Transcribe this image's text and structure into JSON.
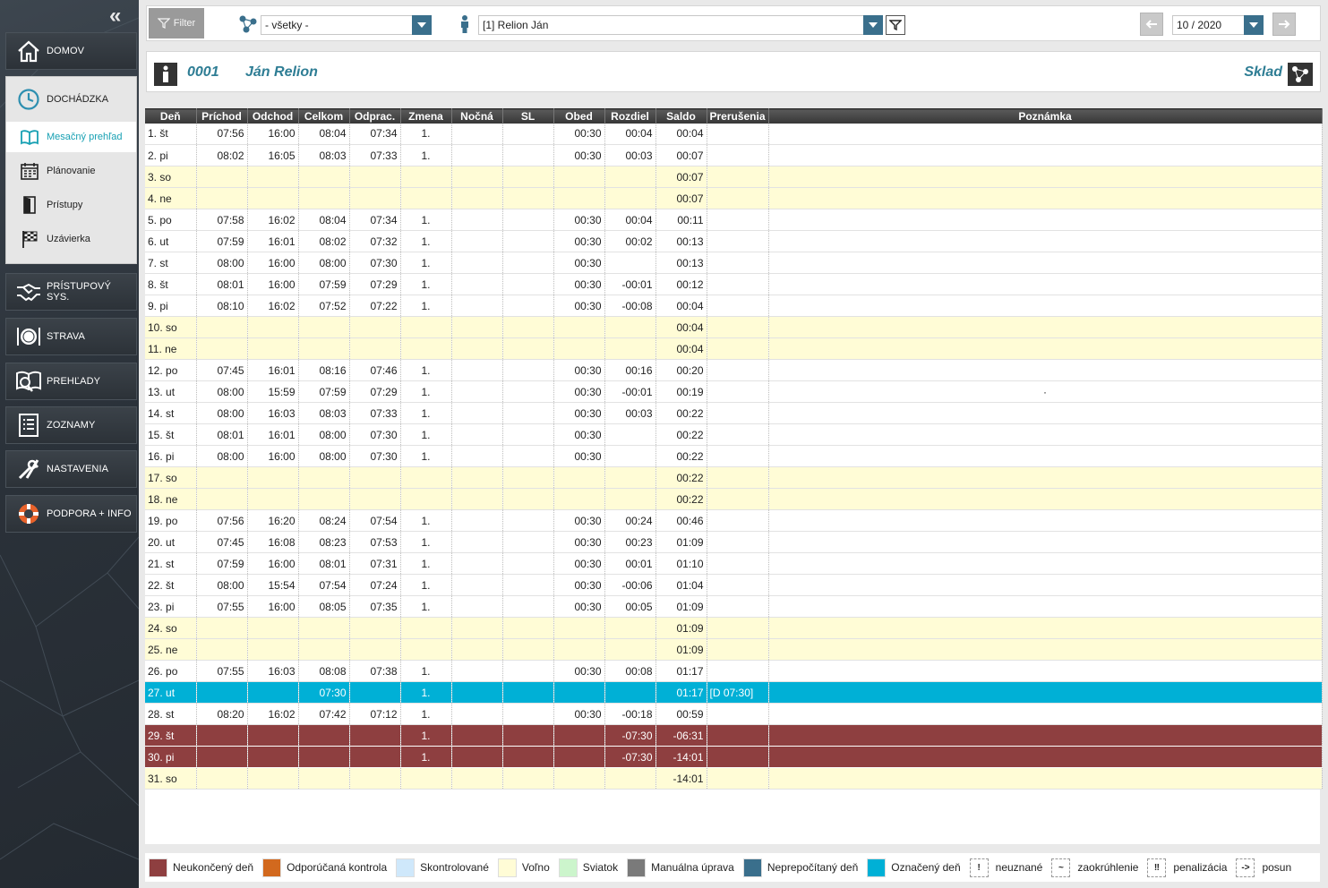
{
  "sidebar": {
    "collapse_glyph": "«",
    "domov": "DOMOV",
    "dochadzka": "DOCHÁDZKA",
    "sub": [
      "Mesačný prehľad",
      "Plánovanie",
      "Prístupy",
      "Uzávierka"
    ],
    "pristup": "PRÍSTUPOVÝ SYS.",
    "strava": "STRAVA",
    "prehlady": "PREHĽADY",
    "zoznamy": "ZOZNAMY",
    "nastavenia": "NASTAVENIA",
    "podpora": "PODPORA + INFO"
  },
  "toolbar": {
    "filter_label": "Filter",
    "group_value": "- všetky -",
    "employee_value": "[1] Relion Ján",
    "period_value": "10 / 2020"
  },
  "employee": {
    "code": "0001",
    "name": "Ján Relion",
    "department": "Sklad"
  },
  "table": {
    "headers": [
      "Deň",
      "Príchod",
      "Odchod",
      "Celkom",
      "Odprac.",
      "Zmena",
      "Nočná",
      "SL",
      "Obed",
      "Rozdiel",
      "Saldo",
      "Prerušenia",
      "Poznámka"
    ],
    "rows": [
      [
        "1. št",
        "07:56",
        "16:00",
        "08:04",
        "07:34",
        "1.",
        "",
        "",
        "00:30",
        "00:04",
        "00:04",
        "",
        ""
      ],
      [
        "2. pi",
        "08:02",
        "16:05",
        "08:03",
        "07:33",
        "1.",
        "",
        "",
        "00:30",
        "00:03",
        "00:07",
        "",
        ""
      ],
      [
        "3. so",
        "",
        "",
        "",
        "",
        "",
        "",
        "",
        "",
        "",
        "00:07",
        "",
        ""
      ],
      [
        "4. ne",
        "",
        "",
        "",
        "",
        "",
        "",
        "",
        "",
        "",
        "00:07",
        "",
        ""
      ],
      [
        "5. po",
        "07:58",
        "16:02",
        "08:04",
        "07:34",
        "1.",
        "",
        "",
        "00:30",
        "00:04",
        "00:11",
        "",
        ""
      ],
      [
        "6. ut",
        "07:59",
        "16:01",
        "08:02",
        "07:32",
        "1.",
        "",
        "",
        "00:30",
        "00:02",
        "00:13",
        "",
        ""
      ],
      [
        "7. st",
        "08:00",
        "16:00",
        "08:00",
        "07:30",
        "1.",
        "",
        "",
        "00:30",
        "",
        "00:13",
        "",
        ""
      ],
      [
        "8. št",
        "08:01",
        "16:00",
        "07:59",
        "07:29",
        "1.",
        "",
        "",
        "00:30",
        "-00:01",
        "00:12",
        "",
        ""
      ],
      [
        "9. pi",
        "08:10",
        "16:02",
        "07:52",
        "07:22",
        "1.",
        "",
        "",
        "00:30",
        "-00:08",
        "00:04",
        "",
        ""
      ],
      [
        "10. so",
        "",
        "",
        "",
        "",
        "",
        "",
        "",
        "",
        "",
        "00:04",
        "",
        ""
      ],
      [
        "11. ne",
        "",
        "",
        "",
        "",
        "",
        "",
        "",
        "",
        "",
        "00:04",
        "",
        ""
      ],
      [
        "12. po",
        "07:45",
        "16:01",
        "08:16",
        "07:46",
        "1.",
        "",
        "",
        "00:30",
        "00:16",
        "00:20",
        "",
        ""
      ],
      [
        "13. ut",
        "08:00",
        "15:59",
        "07:59",
        "07:29",
        "1.",
        "",
        "",
        "00:30",
        "-00:01",
        "00:19",
        "",
        "·"
      ],
      [
        "14. st",
        "08:00",
        "16:03",
        "08:03",
        "07:33",
        "1.",
        "",
        "",
        "00:30",
        "00:03",
        "00:22",
        "",
        ""
      ],
      [
        "15. št",
        "08:01",
        "16:01",
        "08:00",
        "07:30",
        "1.",
        "",
        "",
        "00:30",
        "",
        "00:22",
        "",
        ""
      ],
      [
        "16. pi",
        "08:00",
        "16:00",
        "08:00",
        "07:30",
        "1.",
        "",
        "",
        "00:30",
        "",
        "00:22",
        "",
        ""
      ],
      [
        "17. so",
        "",
        "",
        "",
        "",
        "",
        "",
        "",
        "",
        "",
        "00:22",
        "",
        ""
      ],
      [
        "18. ne",
        "",
        "",
        "",
        "",
        "",
        "",
        "",
        "",
        "",
        "00:22",
        "",
        ""
      ],
      [
        "19. po",
        "07:56",
        "16:20",
        "08:24",
        "07:54",
        "1.",
        "",
        "",
        "00:30",
        "00:24",
        "00:46",
        "",
        ""
      ],
      [
        "20. ut",
        "07:45",
        "16:08",
        "08:23",
        "07:53",
        "1.",
        "",
        "",
        "00:30",
        "00:23",
        "01:09",
        "",
        ""
      ],
      [
        "21. st",
        "07:59",
        "16:00",
        "08:01",
        "07:31",
        "1.",
        "",
        "",
        "00:30",
        "00:01",
        "01:10",
        "",
        ""
      ],
      [
        "22. št",
        "08:00",
        "15:54",
        "07:54",
        "07:24",
        "1.",
        "",
        "",
        "00:30",
        "-00:06",
        "01:04",
        "",
        ""
      ],
      [
        "23. pi",
        "07:55",
        "16:00",
        "08:05",
        "07:35",
        "1.",
        "",
        "",
        "00:30",
        "00:05",
        "01:09",
        "",
        ""
      ],
      [
        "24. so",
        "",
        "",
        "",
        "",
        "",
        "",
        "",
        "",
        "",
        "01:09",
        "",
        ""
      ],
      [
        "25. ne",
        "",
        "",
        "",
        "",
        "",
        "",
        "",
        "",
        "",
        "01:09",
        "",
        ""
      ],
      [
        "26. po",
        "07:55",
        "16:03",
        "08:08",
        "07:38",
        "1.",
        "",
        "",
        "00:30",
        "00:08",
        "01:17",
        "",
        ""
      ],
      [
        "27. ut",
        "",
        "",
        "07:30",
        "",
        "1.",
        "",
        "",
        "",
        "",
        "01:17",
        "[D 07:30]",
        ""
      ],
      [
        "28. st",
        "08:20",
        "16:02",
        "07:42",
        "07:12",
        "1.",
        "",
        "",
        "00:30",
        "-00:18",
        "00:59",
        "",
        ""
      ],
      [
        "29. št",
        "",
        "",
        "",
        "",
        "1.",
        "",
        "",
        "",
        "-07:30",
        "-06:31",
        "",
        ""
      ],
      [
        "30. pi",
        "",
        "",
        "",
        "",
        "1.",
        "",
        "",
        "",
        "-07:30",
        "-14:01",
        "",
        ""
      ],
      [
        "31. so",
        "",
        "",
        "",
        "",
        "",
        "",
        "",
        "",
        "",
        "-14:01",
        "",
        ""
      ]
    ],
    "row_types": [
      "w",
      "w",
      "o",
      "o",
      "w",
      "w",
      "w",
      "w",
      "w",
      "o",
      "o",
      "w",
      "w",
      "w",
      "w",
      "w",
      "o",
      "o",
      "w",
      "w",
      "w",
      "w",
      "w",
      "o",
      "o",
      "w",
      "m",
      "w",
      "n",
      "n",
      "o"
    ]
  },
  "legend": {
    "colors": [
      {
        "label": "Neukončený deň",
        "color": "#8e3f40"
      },
      {
        "label": "Odporúčaná kontrola",
        "color": "#d2691e"
      },
      {
        "label": "Skontrolované",
        "color": "#cfe8fb"
      },
      {
        "label": "Voľno",
        "color": "#fffcd6"
      },
      {
        "label": "Sviatok",
        "color": "#ccf5cc"
      },
      {
        "label": "Manuálna úprava",
        "color": "#7a7a7a"
      },
      {
        "label": "Neprepočítaný deň",
        "color": "#3a6f8c"
      },
      {
        "label": "Označený deň",
        "color": "#00b0d6"
      }
    ],
    "symbols": [
      {
        "sym": "!",
        "label": "neuznané"
      },
      {
        "sym": "~",
        "label": "zaokrúhlenie"
      },
      {
        "sym": "‼",
        "label": "penalizácia"
      },
      {
        "sym": "->",
        "label": "posun"
      }
    ]
  }
}
